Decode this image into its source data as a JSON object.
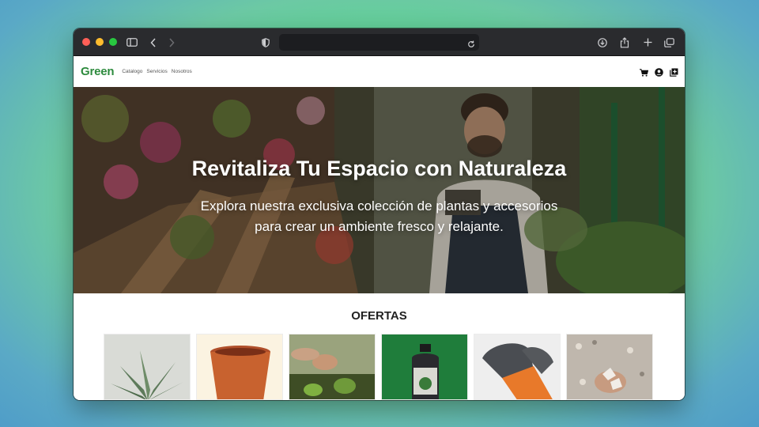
{
  "site": {
    "logo": "Green",
    "nav": [
      "Catalogo",
      "Servicios",
      "Nosotros"
    ]
  },
  "hero": {
    "title": "Revitaliza Tu Espacio con Naturaleza",
    "subtitle": "Explora nuestra exclusiva colección de plantas y accesorios para crear un ambiente fresco y relajante."
  },
  "offers": {
    "heading": "OFERTAS",
    "products": [
      {
        "image": "aloe-plant-photo"
      },
      {
        "image": "terracotta-pot-photo"
      },
      {
        "image": "planting-hands-photo"
      },
      {
        "image": "fertilizer-bottle-photo"
      },
      {
        "image": "garden-gloves-photo"
      },
      {
        "image": "gravel-stones-photo"
      }
    ]
  },
  "colors": {
    "brand": "#2e8b3e",
    "chrome": "#2a2b2e"
  }
}
